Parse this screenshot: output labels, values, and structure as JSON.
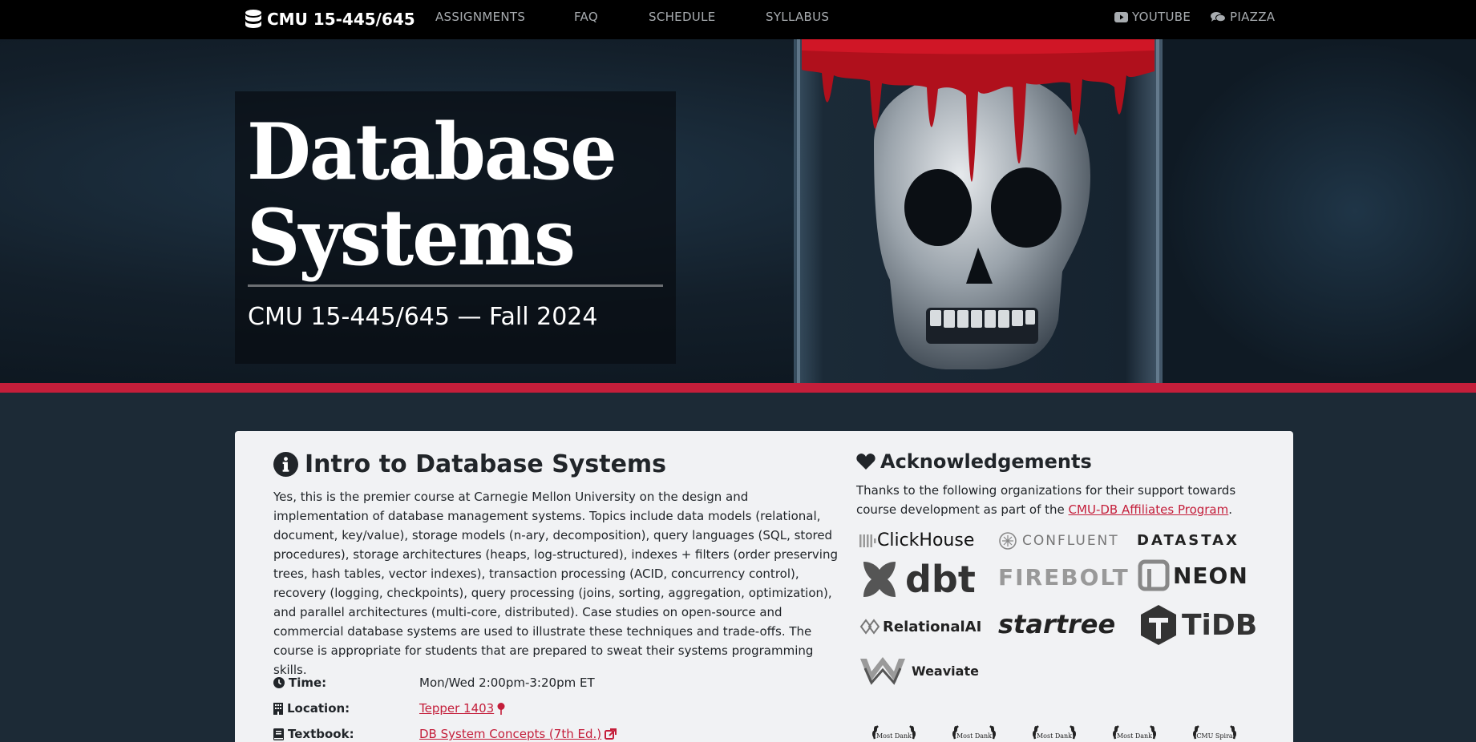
{
  "navbar": {
    "brand": "CMU 15-445/645",
    "links": [
      "ASSIGNMENTS",
      "FAQ",
      "SCHEDULE",
      "SYLLABUS"
    ],
    "youtube": "YOUTUBE",
    "piazza": "PIAZZA"
  },
  "hero": {
    "title_line1": "Database",
    "title_line2": "Systems",
    "subtitle": "CMU 15-445/645 — Fall 2024"
  },
  "intro": {
    "title": "Intro to Database Systems",
    "description": "Yes, this is the premier course at Carnegie Mellon University on the design and implementation of database management systems. Topics include data models (relational, document, key/value), storage models (n-ary, decomposition), query languages (SQL, stored procedures), storage architectures (heaps, log-structured), indexes + filters (order preserving trees, hash tables, vector indexes), transaction processing (ACID, concurrency control), recovery (logging, checkpoints), query processing (joins, sorting, aggregation, optimization), and parallel architectures (multi-core, distributed). Case studies on open-source and commercial database systems are used to illustrate these techniques and trade-offs. The course is appropriate for students that are prepared to sweat their systems programming skills.",
    "time_label": "Time:",
    "time_value": "Mon/Wed 2:00pm-3:20pm ET",
    "location_label": "Location:",
    "location_value": "Tepper 1403",
    "textbook_label": "Textbook:",
    "textbook_value": "DB System Concepts (7th Ed.)"
  },
  "acknowledgements": {
    "title": "Acknowledgements",
    "text_before": "Thanks to the following organizations for their support towards course development as part of the ",
    "link": "CMU-DB Affiliates Program",
    "text_after": ".",
    "sponsors": [
      "ClickHouse",
      "CONFLUENT",
      "DATASTAX",
      "dbt",
      "FIREBOLT",
      "NEON",
      "RelationalAI",
      "startree",
      "TiDB",
      "Weaviate"
    ],
    "awards": [
      "Most Dank",
      "Most Dank",
      "Most Dank",
      "Most Dank",
      "CMU Spira"
    ]
  }
}
